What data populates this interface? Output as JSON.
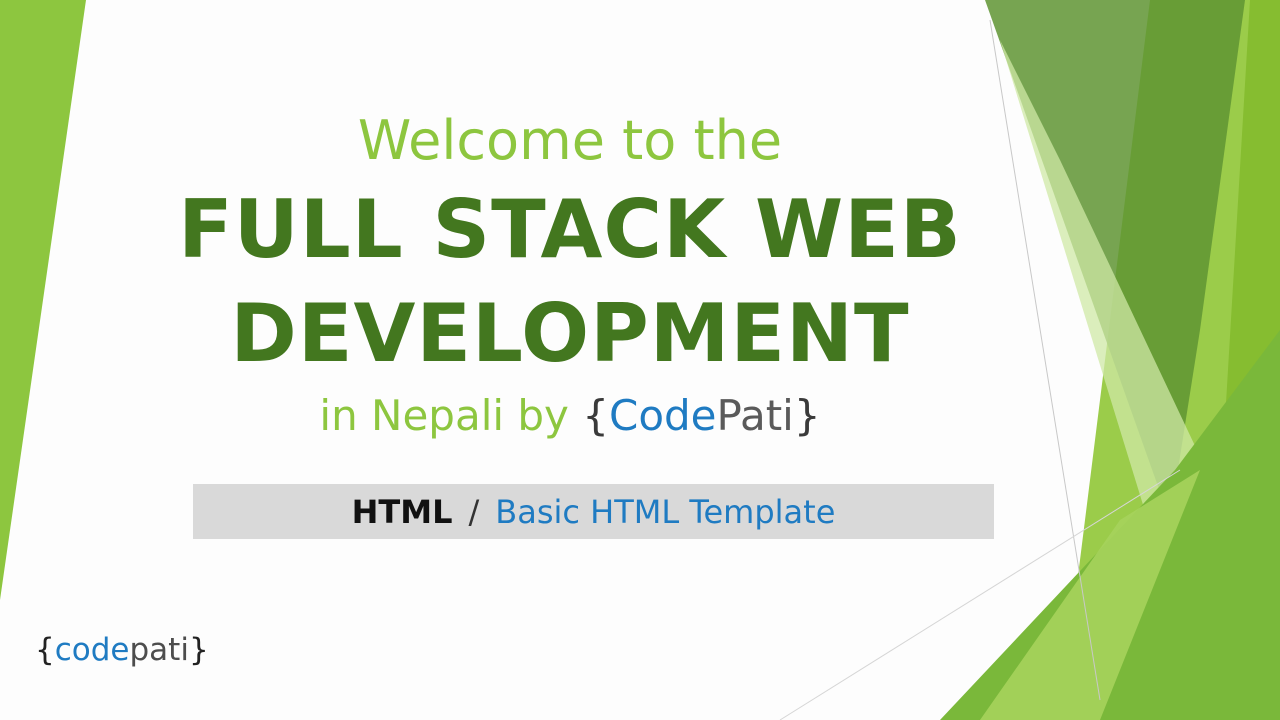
{
  "slide": {
    "welcome": "Welcome to the",
    "headline_line1": "FULL STACK WEB",
    "headline_line2": "DEVELOPMENT",
    "subtitle_prefix": "in Nepali by ",
    "brand": {
      "open_brace": "{",
      "code": "Code",
      "pati": "Pati",
      "close_brace": "}"
    }
  },
  "breadcrumb": {
    "topic": "HTML",
    "separator": "/",
    "lesson": "Basic HTML Template"
  },
  "logo": {
    "open_brace": "{",
    "code": "code",
    "pati": "pati",
    "close_brace": "}"
  },
  "colors": {
    "accent_light_green": "#8dc63f",
    "accent_dark_green": "#43771f",
    "brand_blue": "#1f7bc2",
    "breadcrumb_bar": "#d9d9d9"
  }
}
